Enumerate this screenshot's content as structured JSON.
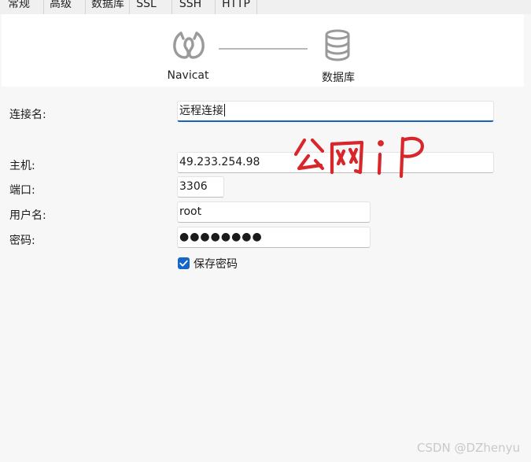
{
  "tabs": [
    {
      "label": "常规"
    },
    {
      "label": "高级"
    },
    {
      "label": "数据库"
    },
    {
      "label": "SSL"
    },
    {
      "label": "SSH"
    },
    {
      "label": "HTTP"
    }
  ],
  "banner": {
    "source_label": "Navicat",
    "target_label": "数据库"
  },
  "form": {
    "connection_name_label": "连接名:",
    "connection_name_value": "远程连接",
    "host_label": "主机:",
    "host_value": "49.233.254.98",
    "port_label": "端口:",
    "port_value": "3306",
    "username_label": "用户名:",
    "username_value": "root",
    "password_label": "密码:",
    "password_value": "●●●●●●●●",
    "save_password_label": "保存密码",
    "save_password_checked": true
  },
  "annotation": {
    "text": "公网 iP",
    "color": "#d9262b"
  },
  "watermark": "CSDN @DZhenyu",
  "colors": {
    "accent": "#1466c7",
    "background": "#f7f7f7",
    "icon_gray": "#9a9a9a"
  }
}
